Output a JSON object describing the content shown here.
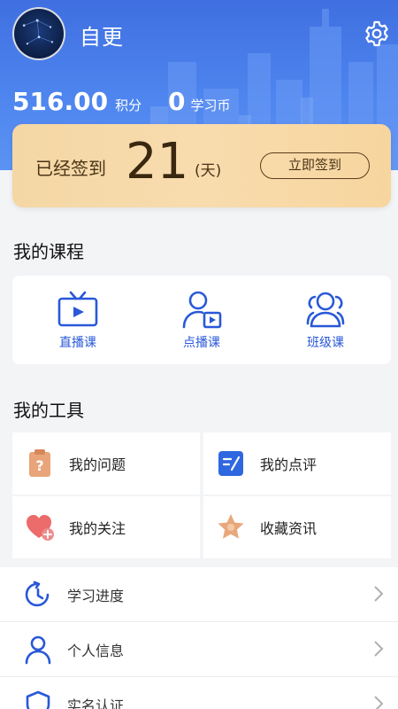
{
  "profile": {
    "username": "自更"
  },
  "stats": {
    "points_value": "516.00",
    "points_unit": "积分",
    "coins_value": "0",
    "coins_unit": "学习币"
  },
  "signin": {
    "label": "已经签到",
    "days": "21",
    "days_unit": "(天)",
    "button": "立即签到"
  },
  "courses": {
    "title": "我的课程",
    "items": [
      {
        "label": "直播课",
        "icon": "tv-icon"
      },
      {
        "label": "点播课",
        "icon": "user-video-icon"
      },
      {
        "label": "班级课",
        "icon": "group-icon"
      }
    ]
  },
  "tools": {
    "title": "我的工具",
    "items": [
      {
        "label": "我的问题",
        "icon": "question-clipboard-icon"
      },
      {
        "label": "我的点评",
        "icon": "edit-note-icon"
      },
      {
        "label": "我的关注",
        "icon": "heart-plus-icon"
      },
      {
        "label": "收藏资讯",
        "icon": "star-icon"
      }
    ]
  },
  "menu": {
    "items": [
      {
        "label": "学习进度",
        "icon": "clock-icon"
      },
      {
        "label": "个人信息",
        "icon": "person-icon"
      },
      {
        "label": "实名认证",
        "icon": "shield-icon"
      }
    ]
  },
  "colors": {
    "header_blue": "#4f86ef",
    "accent_blue": "#2958d8",
    "signin_gold": "#f6d7a4"
  }
}
